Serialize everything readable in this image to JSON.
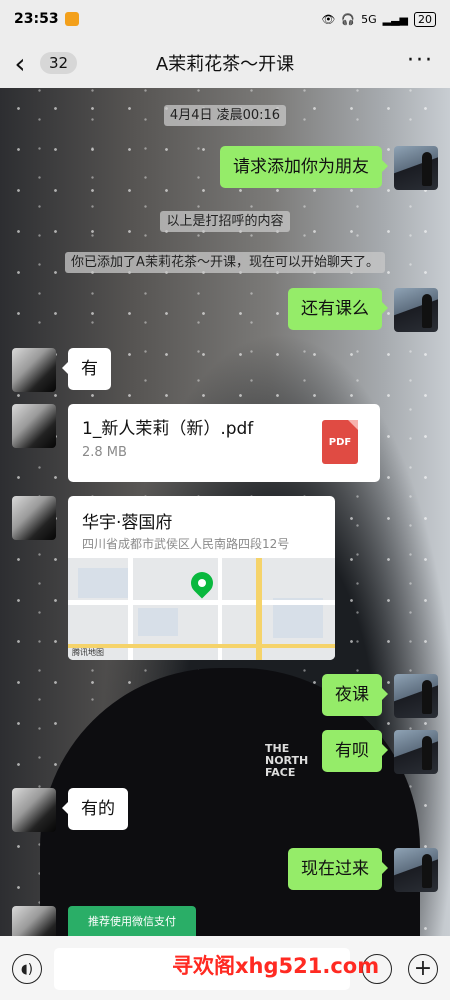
{
  "status_bar": {
    "time": "23:53",
    "signal": "5G",
    "battery": "20"
  },
  "header": {
    "back_count": "32",
    "title": "A茉莉花茶～开课",
    "more": "···"
  },
  "chat": {
    "timestamp": "4月4日 凌晨00:16",
    "messages": [
      {
        "side": "me",
        "text": "请求添加你为朋友"
      },
      {
        "type": "system",
        "text": "以上是打招呼的内容"
      },
      {
        "type": "system",
        "text": "你已添加了A茉莉花茶～开课，现在可以开始聊天了。"
      },
      {
        "side": "me",
        "text": "还有课么"
      },
      {
        "side": "them",
        "text": "有"
      },
      {
        "side": "them",
        "type": "file",
        "name": "1_新人茉莉（新）.pdf",
        "size": "2.8 MB",
        "icon": "PDF"
      },
      {
        "side": "them",
        "type": "location",
        "title": "华宇·蓉国府",
        "address": "四川省成都市武侯区人民南路四段12号",
        "map_credit": "腾讯地图"
      },
      {
        "side": "me",
        "text": "夜课"
      },
      {
        "side": "me",
        "text": "有呗"
      },
      {
        "side": "them",
        "text": "有的"
      },
      {
        "side": "me",
        "text": "现在过来"
      },
      {
        "side": "them",
        "type": "pay",
        "text": "推荐使用微信支付"
      }
    ]
  },
  "background": {
    "jacket_logo": "THE NORTH FACE"
  },
  "input_bar": {
    "value": "",
    "placeholder": ""
  },
  "watermark": "寻欢阁xhg521.com",
  "colors": {
    "my_bubble": "#95ec69",
    "their_bubble": "#ffffff",
    "pay_green": "#2aae67",
    "pdf_red": "#e04b43",
    "watermark": "#ff2a22"
  }
}
